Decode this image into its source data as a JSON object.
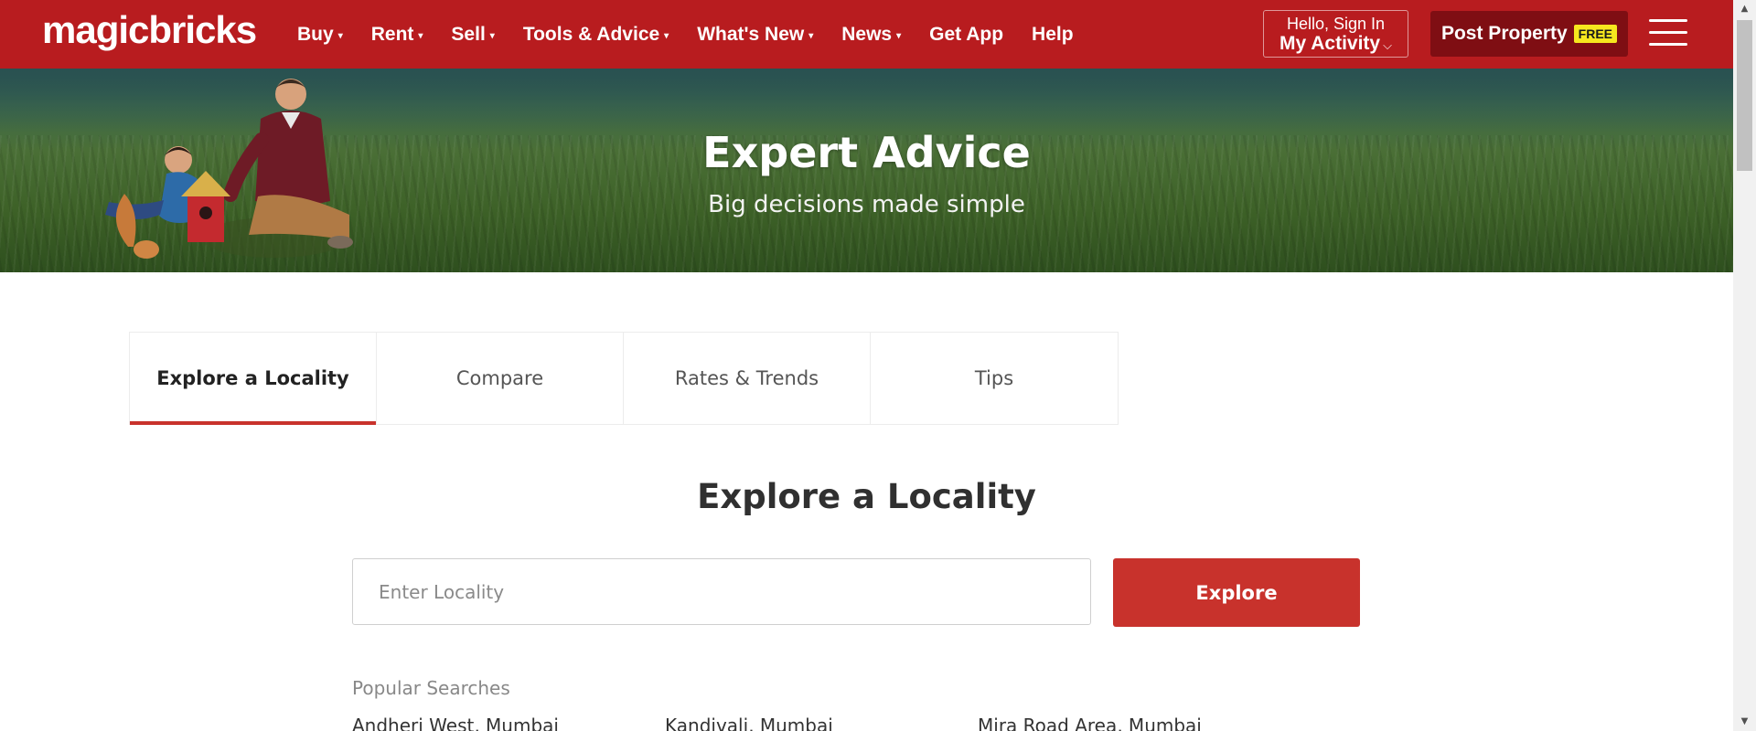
{
  "header": {
    "logo": "magicbricks",
    "nav": [
      {
        "label": "Buy",
        "has_caret": true
      },
      {
        "label": "Rent",
        "has_caret": true
      },
      {
        "label": "Sell",
        "has_caret": true
      },
      {
        "label": "Tools & Advice",
        "has_caret": true
      },
      {
        "label": "What's New",
        "has_caret": true
      },
      {
        "label": "News",
        "has_caret": true
      },
      {
        "label": "Get App",
        "has_caret": false
      },
      {
        "label": "Help",
        "has_caret": false
      }
    ],
    "caret_glyph": "▾",
    "signin": {
      "greeting": "Hello, Sign In",
      "label": "My Activity",
      "chevron": "⌵"
    },
    "post_property": {
      "label": "Post Property",
      "badge": "FREE"
    },
    "colors": {
      "brand_red": "#b81c1f",
      "post_bg": "#7f0e13",
      "badge_yellow": "#f6e71e"
    }
  },
  "hero": {
    "title": "Expert Advice",
    "subtitle": "Big decisions made simple"
  },
  "tabs": [
    {
      "label": "Explore a Locality",
      "active": true
    },
    {
      "label": "Compare",
      "active": false
    },
    {
      "label": "Rates & Trends",
      "active": false
    },
    {
      "label": "Tips",
      "active": false
    }
  ],
  "explore": {
    "title": "Explore a Locality",
    "placeholder": "Enter Locality",
    "button": "Explore",
    "accent": "#c8322c"
  },
  "popular": {
    "label": "Popular Searches",
    "items": [
      "Andheri West, Mumbai",
      "Kandivali, Mumbai",
      "Mira Road Area, Mumbai"
    ]
  },
  "scrollbar": {
    "up": "▲",
    "down": "▼"
  }
}
